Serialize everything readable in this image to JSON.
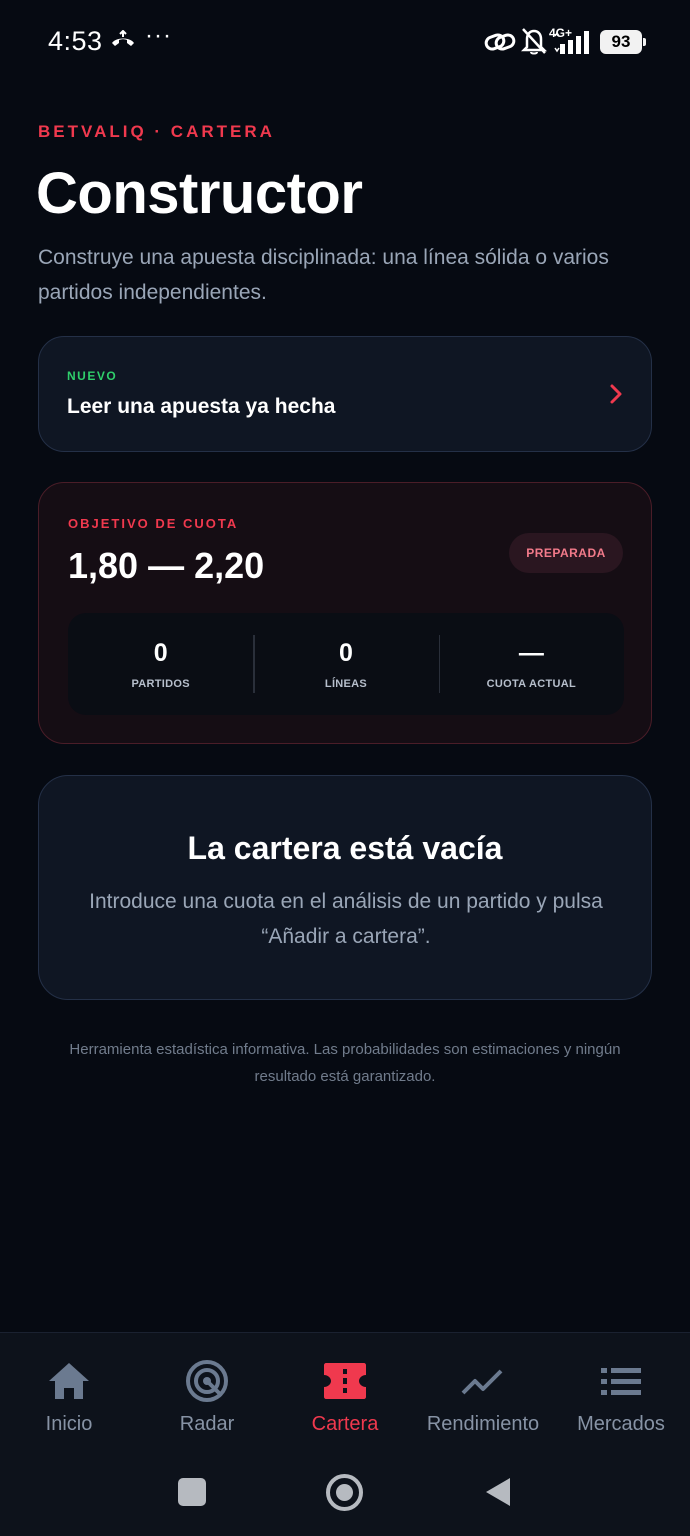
{
  "status_bar": {
    "time": "4:53",
    "dots": "···",
    "network": "4G+",
    "battery": "93",
    "icons": [
      "call-forward-icon",
      "link-icon",
      "bell-off-icon",
      "signal-icon",
      "battery-icon"
    ]
  },
  "header": {
    "eyebrow": "BETVALIQ · CARTERA",
    "title": "Constructor",
    "subtitle": "Construye una apuesta disciplinada: una línea sólida o varios partidos independientes."
  },
  "new_card": {
    "tag": "NUEVO",
    "label": "Leer una apuesta ya hecha",
    "icon": "chevron-right-icon"
  },
  "target_card": {
    "tag": "OBJETIVO DE CUOTA",
    "range": "1,80 — 2,20",
    "badge": "PREPARADA",
    "stats": [
      {
        "value": "0",
        "label": "PARTIDOS"
      },
      {
        "value": "0",
        "label": "LÍNEAS"
      },
      {
        "value": "—",
        "label": "CUOTA ACTUAL"
      }
    ]
  },
  "empty_state": {
    "title": "La cartera está vacía",
    "description": "Introduce una cuota en el análisis de un partido y pulsa “Añadir a cartera”."
  },
  "disclaimer": "Herramienta estadística informativa. Las probabilidades son estimaciones y ningún resultado está garantizado.",
  "bottom_nav": {
    "active": "Cartera",
    "items": [
      {
        "label": "Inicio",
        "icon": "home-icon"
      },
      {
        "label": "Radar",
        "icon": "radar-icon"
      },
      {
        "label": "Cartera",
        "icon": "ticket-icon"
      },
      {
        "label": "Rendimiento",
        "icon": "trend-icon"
      },
      {
        "label": "Mercados",
        "icon": "list-icon"
      }
    ]
  },
  "colors": {
    "accent": "#f0394e",
    "new_tag": "#2fcf6b",
    "background": "#060a12",
    "card": "#0f1623",
    "muted_text": "#9aa6b7",
    "nav_inactive": "#8793a5"
  }
}
